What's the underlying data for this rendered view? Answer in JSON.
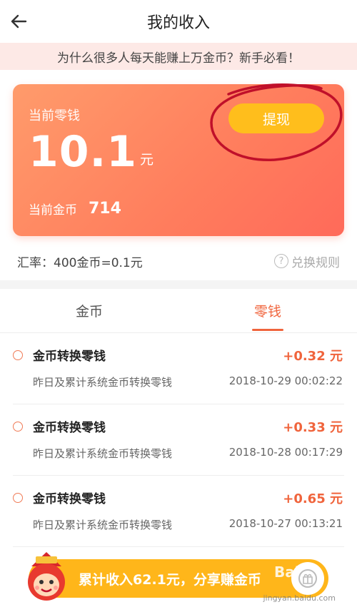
{
  "header": {
    "title": "我的收入"
  },
  "banner": {
    "text": "为什么很多人每天能赚上万金币？新手必看！"
  },
  "card": {
    "change_label": "当前零钱",
    "amount": "10.1",
    "unit": "元",
    "coins_label": "当前金币",
    "coins_value": "714",
    "withdraw_label": "提现"
  },
  "rate": {
    "text": "汇率：400金币=0.1元",
    "rules_label": "兑换规则",
    "rules_icon": "?"
  },
  "tabs": [
    {
      "label": "金币"
    },
    {
      "label": "零钱"
    }
  ],
  "records": [
    {
      "title": "金币转换零钱",
      "amount": "+0.32 元",
      "desc": "昨日及累计系统金币转换零钱",
      "time": "2018-10-29 00:02:22"
    },
    {
      "title": "金币转换零钱",
      "amount": "+0.33 元",
      "desc": "昨日及累计系统金币转换零钱",
      "time": "2018-10-28 00:17:29"
    },
    {
      "title": "金币转换零钱",
      "amount": "+0.65 元",
      "desc": "昨日及累计系统金币转换零钱",
      "time": "2018-10-27 00:13:21"
    }
  ],
  "share": {
    "text": "累计收入62.1元，分享赚金币"
  },
  "watermark": {
    "logo": "Bai",
    "url": "jingyan.baidu.com"
  },
  "colors": {
    "accent": "#f0643c",
    "card": "#ff8a62",
    "button": "#ffbe1c",
    "circle": "#c0102a"
  }
}
